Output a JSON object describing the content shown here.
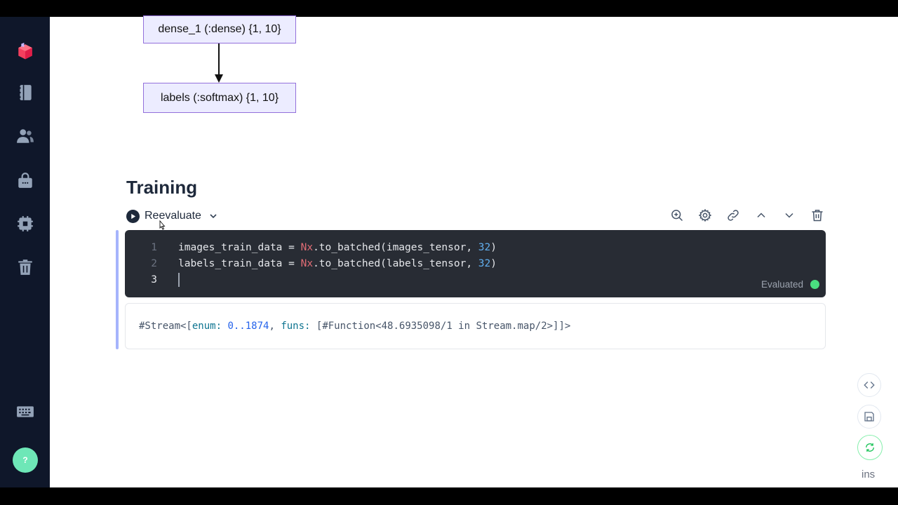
{
  "diagram": {
    "node_top": "dense_1 (:dense) {1, 10}",
    "node_bottom": "labels (:softmax) {1, 10}"
  },
  "section": {
    "title": "Training"
  },
  "cell": {
    "reevaluate_label": "Reevaluate",
    "lines": [
      {
        "no": "1",
        "var": "images_train_data = ",
        "mod": "Nx",
        "call": ".to_batched(images_tensor, ",
        "num": "32",
        "end": ")"
      },
      {
        "no": "2",
        "var": "labels_train_data = ",
        "mod": "Nx",
        "call": ".to_batched(labels_tensor, ",
        "num": "32",
        "end": ")"
      },
      {
        "no": "3"
      }
    ],
    "status_label": "Evaluated",
    "status_color": "#4ade80",
    "output": {
      "p1": "#Stream<[",
      "k1": "enum:",
      "v1": " 0..1874",
      "p2": ", ",
      "k2": "funs:",
      "p3": " [#Function<48.6935098/1 in Stream.map/2>]]>"
    }
  },
  "sidebar": {
    "icons": [
      "livebook-logo-icon",
      "notebooks-icon",
      "users-icon",
      "secrets-icon",
      "runtime-icon",
      "bin-icon",
      "keyboard-icon",
      "help-icon"
    ],
    "help_label": "?"
  },
  "right_fabs": {
    "ins_label": "ins"
  }
}
